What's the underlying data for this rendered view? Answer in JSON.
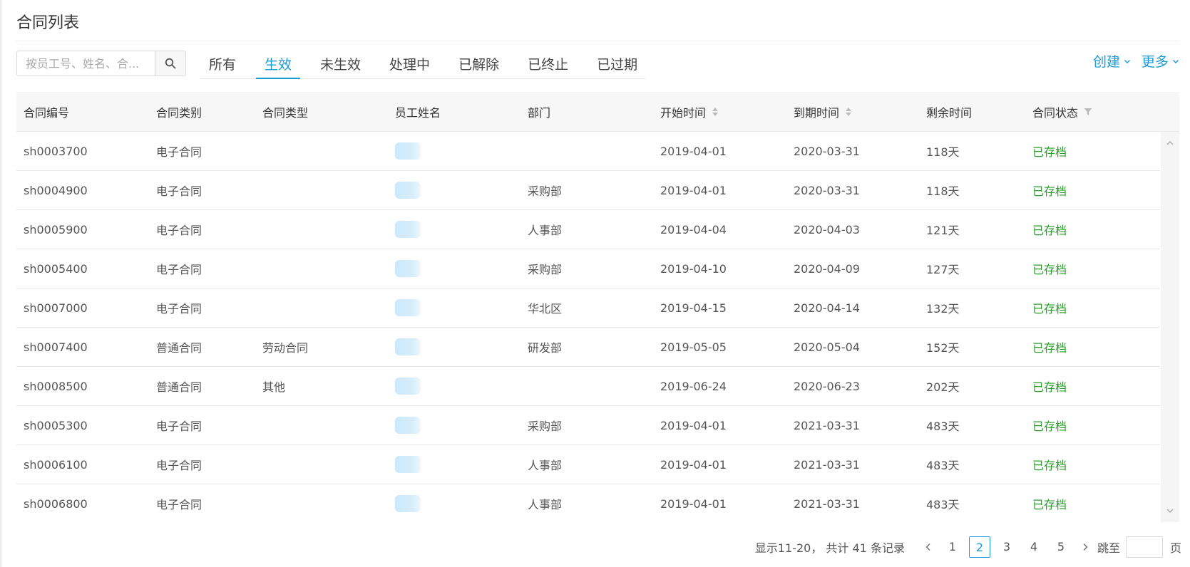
{
  "page": {
    "title": "合同列表"
  },
  "search": {
    "placeholder": "按员工号、姓名、合..."
  },
  "tabs": [
    {
      "label": "所有",
      "active": false
    },
    {
      "label": "生效",
      "active": true
    },
    {
      "label": "未生效",
      "active": false
    },
    {
      "label": "处理中",
      "active": false
    },
    {
      "label": "已解除",
      "active": false
    },
    {
      "label": "已终止",
      "active": false
    },
    {
      "label": "已过期",
      "active": false
    }
  ],
  "actions": {
    "create_label": "创建",
    "more_label": "更多"
  },
  "table": {
    "headers": [
      "合同编号",
      "合同类别",
      "合同类型",
      "员工姓名",
      "部门",
      "开始时间",
      "到期时间",
      "剩余时间",
      "合同状态"
    ],
    "rows": [
      [
        "sh0003700",
        "电子合同",
        "",
        "",
        "",
        "2019-04-01",
        "2020-03-31",
        "118天",
        "已存档"
      ],
      [
        "sh0004900",
        "电子合同",
        "",
        "",
        "采购部",
        "2019-04-01",
        "2020-03-31",
        "118天",
        "已存档"
      ],
      [
        "sh0005900",
        "电子合同",
        "",
        "",
        "人事部",
        "2019-04-04",
        "2020-04-03",
        "121天",
        "已存档"
      ],
      [
        "sh0005400",
        "电子合同",
        "",
        "",
        "采购部",
        "2019-04-10",
        "2020-04-09",
        "127天",
        "已存档"
      ],
      [
        "sh0007000",
        "电子合同",
        "",
        "",
        "华北区",
        "2019-04-15",
        "2020-04-14",
        "132天",
        "已存档"
      ],
      [
        "sh0007400",
        "普通合同",
        "劳动合同",
        "",
        "研发部",
        "2019-05-05",
        "2020-05-04",
        "152天",
        "已存档"
      ],
      [
        "sh0008500",
        "普通合同",
        "其他",
        "",
        "",
        "2019-06-24",
        "2020-06-23",
        "202天",
        "已存档"
      ],
      [
        "sh0005300",
        "电子合同",
        "",
        "",
        "采购部",
        "2019-04-01",
        "2021-03-31",
        "483天",
        "已存档"
      ],
      [
        "sh0006100",
        "电子合同",
        "",
        "",
        "人事部",
        "2019-04-01",
        "2021-03-31",
        "483天",
        "已存档"
      ],
      [
        "sh0006800",
        "电子合同",
        "",
        "",
        "人事部",
        "2019-04-01",
        "2021-03-31",
        "483天",
        "已存档"
      ]
    ]
  },
  "pagination": {
    "summary": "显示11-20， 共计 41 条记录",
    "pages": [
      "1",
      "2",
      "3",
      "4",
      "5"
    ],
    "current": "2",
    "jump_label": "跳至",
    "jump_value": "",
    "jump_unit": "页"
  },
  "colors": {
    "accent": "#1a9bd7",
    "status_green": "#2a9d2a"
  },
  "icons": {
    "search": "search-icon",
    "sort": "sort-icon",
    "filter": "filter-icon",
    "chevron_down": "chevron-down-icon",
    "chevron_left": "chevron-left-icon",
    "chevron_right": "chevron-right-icon",
    "scroll_up": "scroll-up-icon",
    "scroll_down": "scroll-down-icon"
  }
}
